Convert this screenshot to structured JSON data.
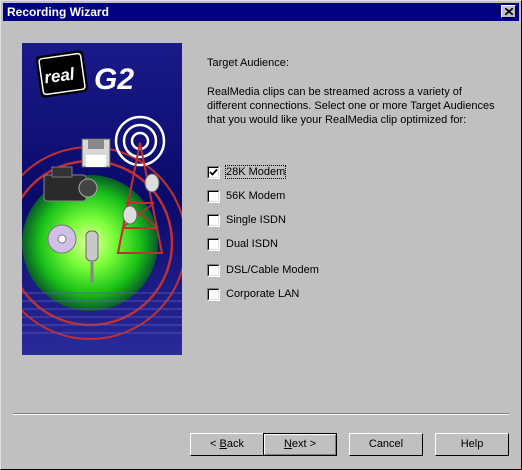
{
  "window": {
    "title": "Recording Wizard"
  },
  "banner": {
    "logo_text": "real",
    "logo_g2": "G2"
  },
  "content": {
    "heading": "Target Audience:",
    "description": "RealMedia clips can be streamed across a variety of different connections.  Select one or more Target Audiences that you would like your RealMedia clip optimized for:"
  },
  "options": [
    {
      "label": "28K Modem",
      "checked": true
    },
    {
      "label": "56K Modem",
      "checked": false
    },
    {
      "label": "Single ISDN",
      "checked": false
    },
    {
      "label": "Dual ISDN",
      "checked": false
    },
    {
      "label": "DSL/Cable Modem",
      "checked": false
    },
    {
      "label": "Corporate LAN",
      "checked": false
    }
  ],
  "buttons": {
    "back": {
      "mnemonic": "B",
      "rest": "ack",
      "prefix": "< "
    },
    "next": {
      "mnemonic": "N",
      "rest": "ext >"
    },
    "cancel": "Cancel",
    "help": "Help"
  }
}
